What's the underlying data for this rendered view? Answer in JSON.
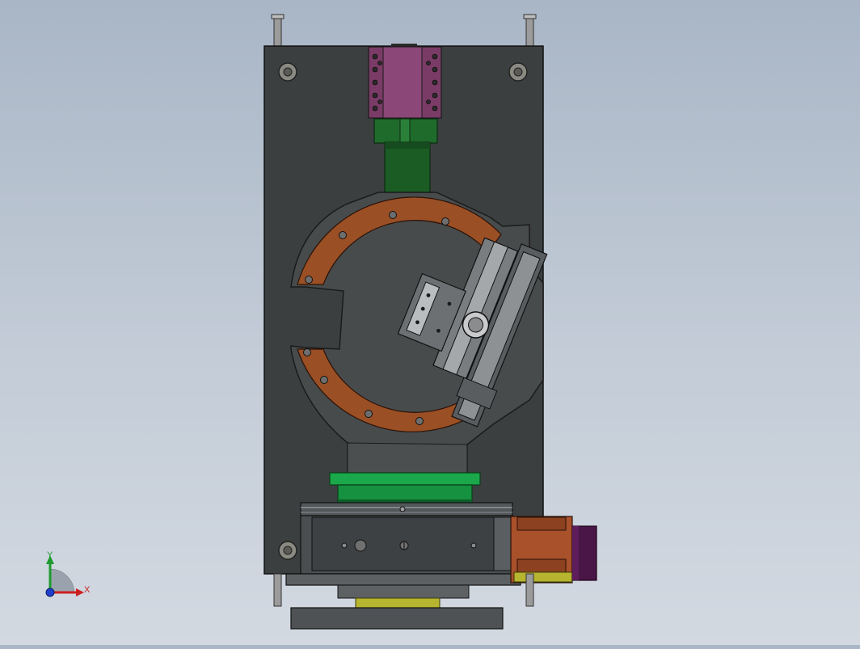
{
  "view": {
    "background_top": "#a9b6c6",
    "background_bottom": "#d3d9e1"
  },
  "colors": {
    "base_plate": "#3c3f40",
    "pink_block": "#7a3c67",
    "green_part": "#1f6b2b",
    "bright_green": "#1aa84a",
    "copper_ring": "#9a4f25",
    "motor_orange": "#a8512b",
    "motor_cap": "#4a1547",
    "yellow_part": "#b7b42f"
  },
  "triad": {
    "x_label": "X",
    "y_label": "Y",
    "x_color": "#cc1f1f",
    "y_color": "#1f9a2e",
    "z_color": "#1f3fcc"
  }
}
